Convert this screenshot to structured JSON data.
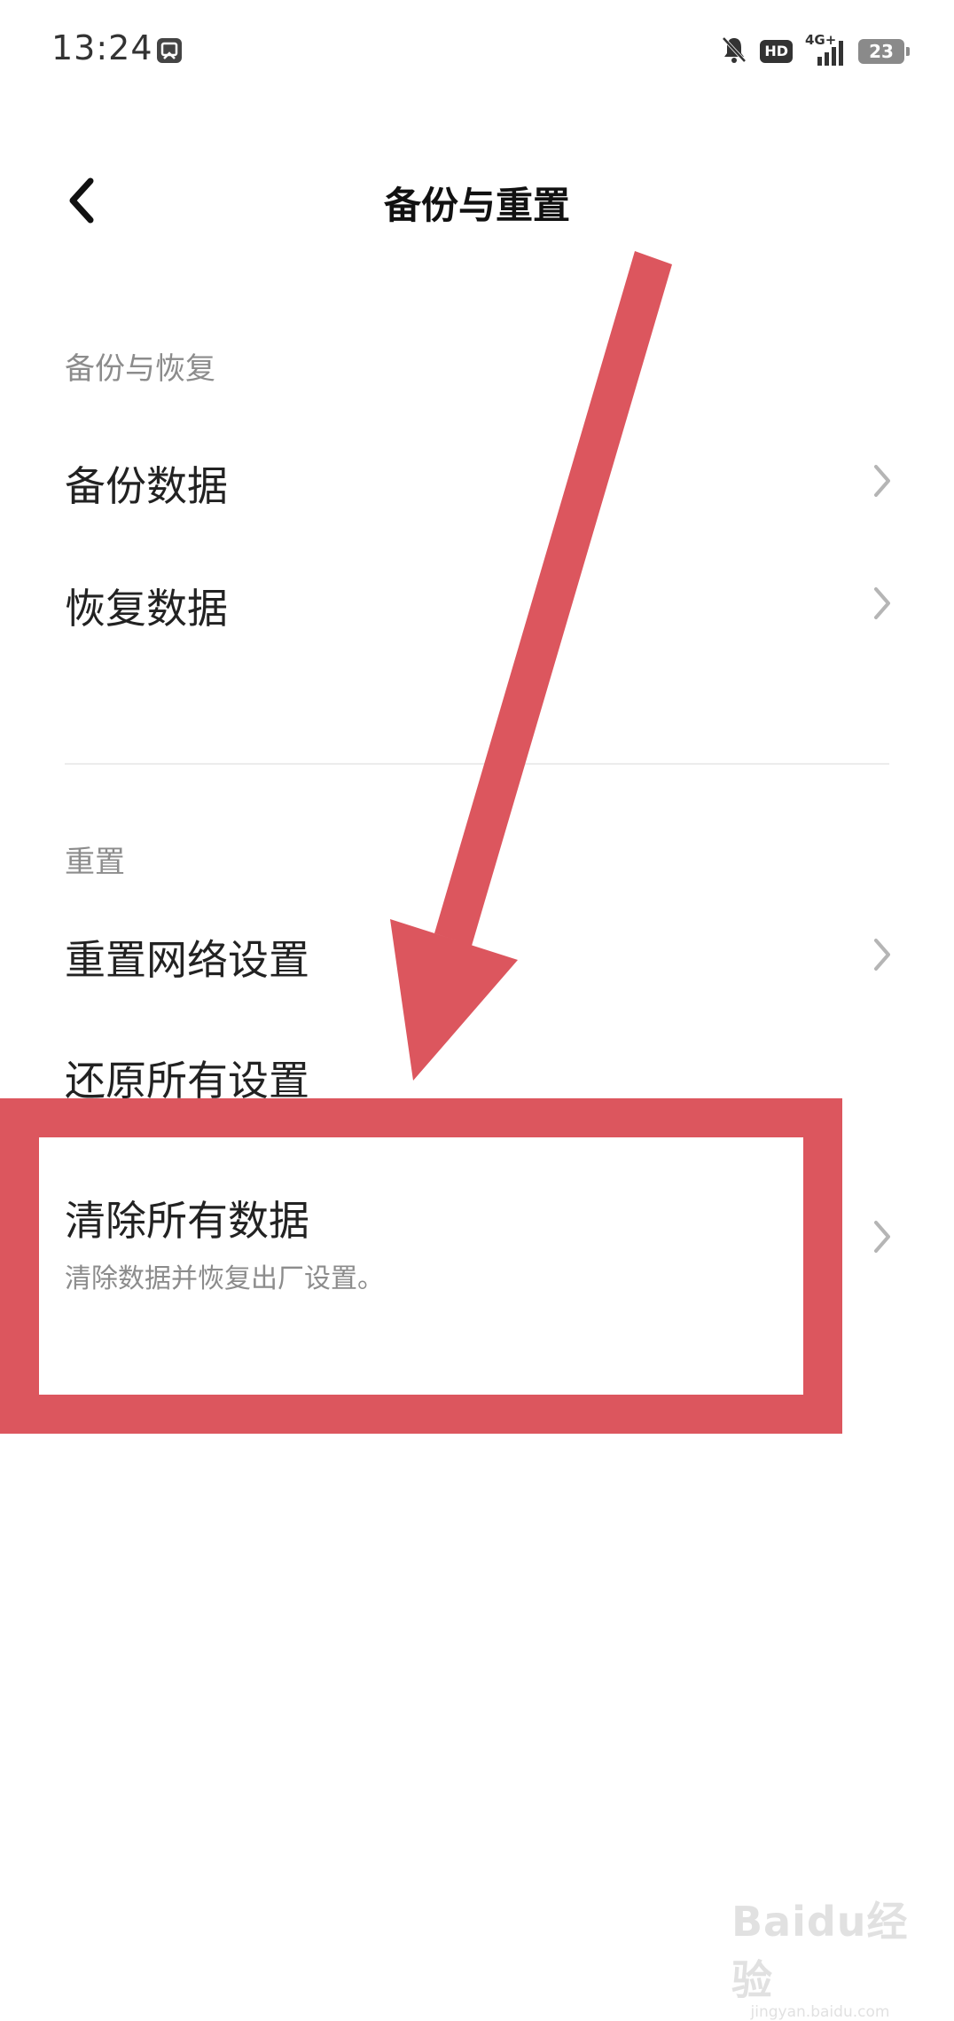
{
  "status_bar": {
    "time": "13:24",
    "hd_label": "HD",
    "network_label": "4G+",
    "battery_level": "23"
  },
  "header": {
    "title": "备份与重置"
  },
  "sections": {
    "backup": {
      "label": "备份与恢复",
      "items": [
        {
          "label": "备份数据"
        },
        {
          "label": "恢复数据"
        }
      ]
    },
    "reset": {
      "label": "重置",
      "items": [
        {
          "label": "重置网络设置"
        },
        {
          "label": "还原所有设置"
        },
        {
          "label": "清除所有数据",
          "subtitle": "清除数据并恢复出厂设置。"
        }
      ]
    }
  },
  "annotation": {
    "color": "#dc565e"
  },
  "watermark": {
    "logo": "Baidu经验",
    "url": "jingyan.baidu.com"
  }
}
